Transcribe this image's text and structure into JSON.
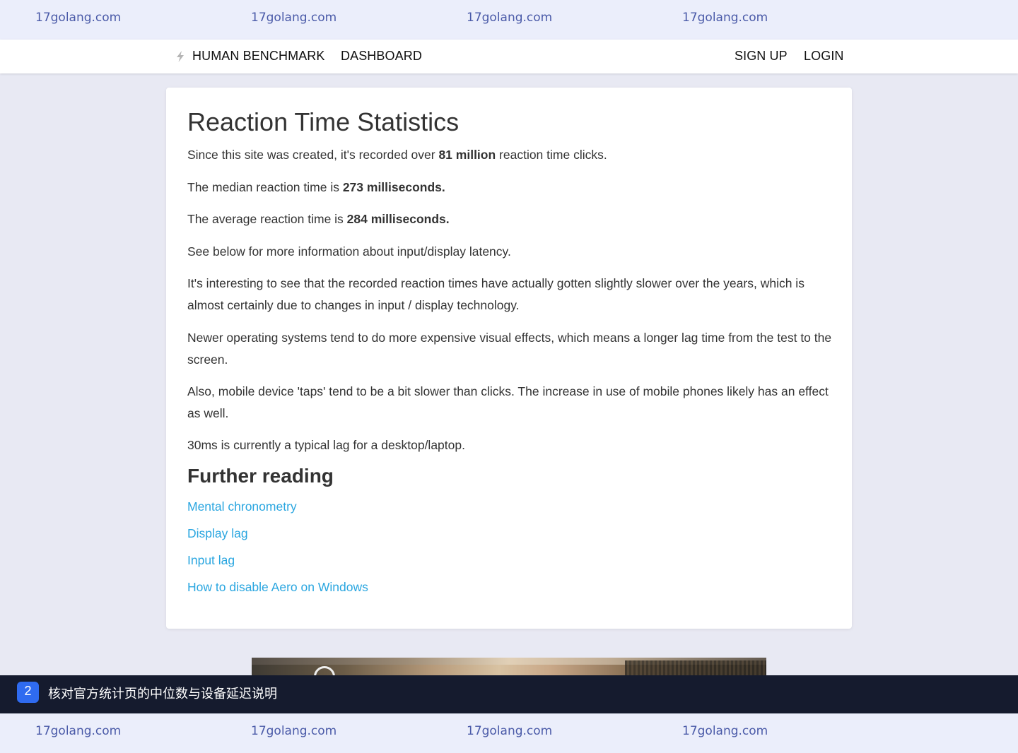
{
  "watermark": {
    "text": "17golang.com"
  },
  "nav": {
    "brand": "HUMAN BENCHMARK",
    "dashboard": "DASHBOARD",
    "signup": "SIGN UP",
    "login": "LOGIN"
  },
  "article": {
    "title": "Reaction Time Statistics",
    "p1_before": "Since this site was created, it's recorded over ",
    "p1_bold": "81 million",
    "p1_after": " reaction time clicks.",
    "p2_before": "The median reaction time is ",
    "p2_bold": "273 milliseconds.",
    "p3_before": "The average reaction time is ",
    "p3_bold": "284 milliseconds.",
    "p4": "See below for more information about input/display latency.",
    "p5": "It's interesting to see that the recorded reaction times have actually gotten slightly slower over the years, which is almost certainly due to changes in input / display technology.",
    "p6": "Newer operating systems tend to do more expensive visual effects, which means a longer lag time from the test to the screen.",
    "p7": "Also, mobile device 'taps' tend to be a bit slower than clicks. The increase in use of mobile phones likely has an effect as well.",
    "p8": "30ms is currently a typical lag for a desktop/laptop.",
    "further_title": "Further reading",
    "links": [
      "Mental chronometry",
      "Display lag",
      "Input lag",
      "How to disable Aero on Windows"
    ]
  },
  "banner": {
    "step": "2",
    "text": "核对官方统计页的中位数与设备延迟说明"
  },
  "colors": {
    "link": "#2aa6e0",
    "badge": "#2f6bf0",
    "banner_bg": "#151b2e",
    "watermark": "#4a5aa8"
  }
}
